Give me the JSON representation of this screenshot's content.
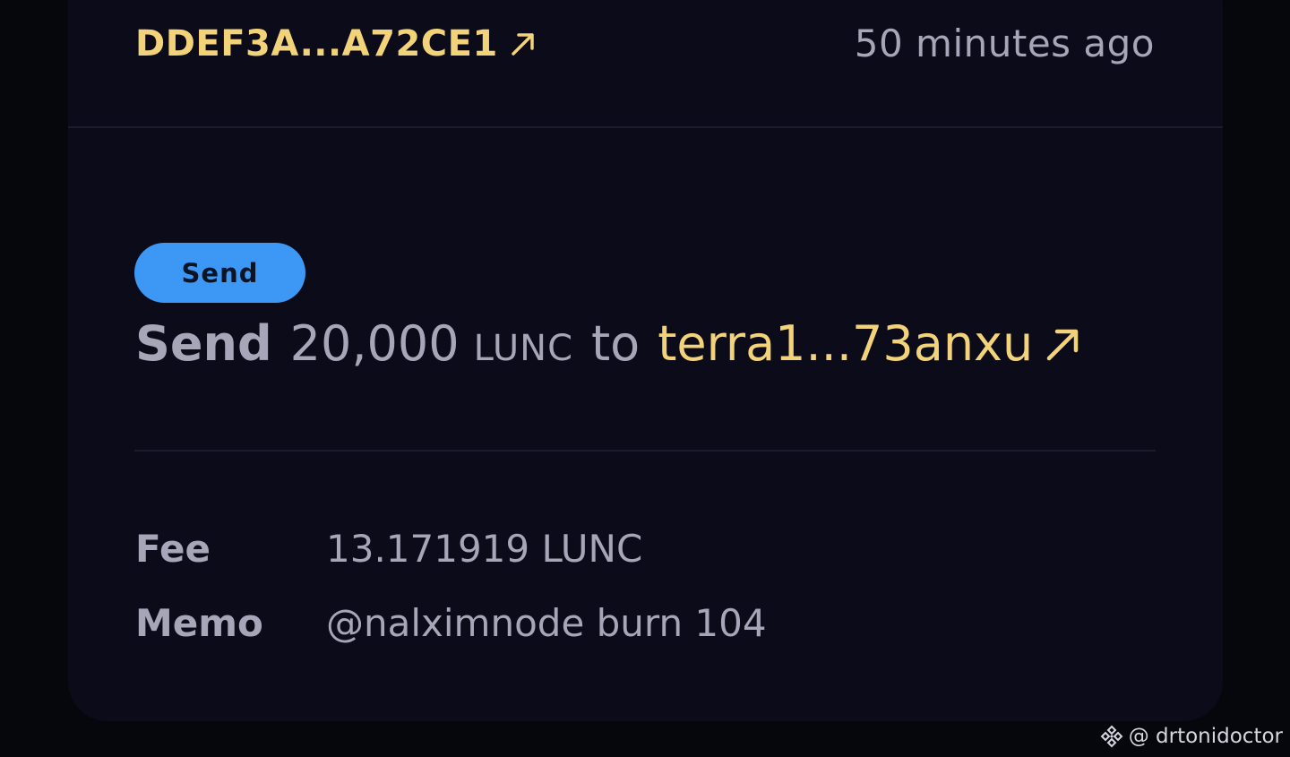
{
  "tx": {
    "hash": "DDEF3A...A72CE1",
    "time": "50 minutes ago",
    "badge": "Send",
    "message": {
      "action": "Send",
      "amount": "20,000",
      "denom": "LUNC",
      "connector": "to",
      "recipient": "terra1...73anxu"
    },
    "fee": {
      "label": "Fee",
      "value": "13.171919 LUNC"
    },
    "memo": {
      "label": "Memo",
      "value": "@nalximnode burn 104"
    }
  },
  "watermark": "@ drtonidoctor",
  "icons": {
    "hash_link": "external-link-arrow-icon",
    "recipient_link": "external-link-arrow-icon",
    "watermark": "binance-logo-icon"
  },
  "colors": {
    "accent_gold": "#f3d37a",
    "badge_blue": "#3c97f5",
    "muted_text": "#a6a6b8",
    "card_bg": "#0b0b19"
  }
}
